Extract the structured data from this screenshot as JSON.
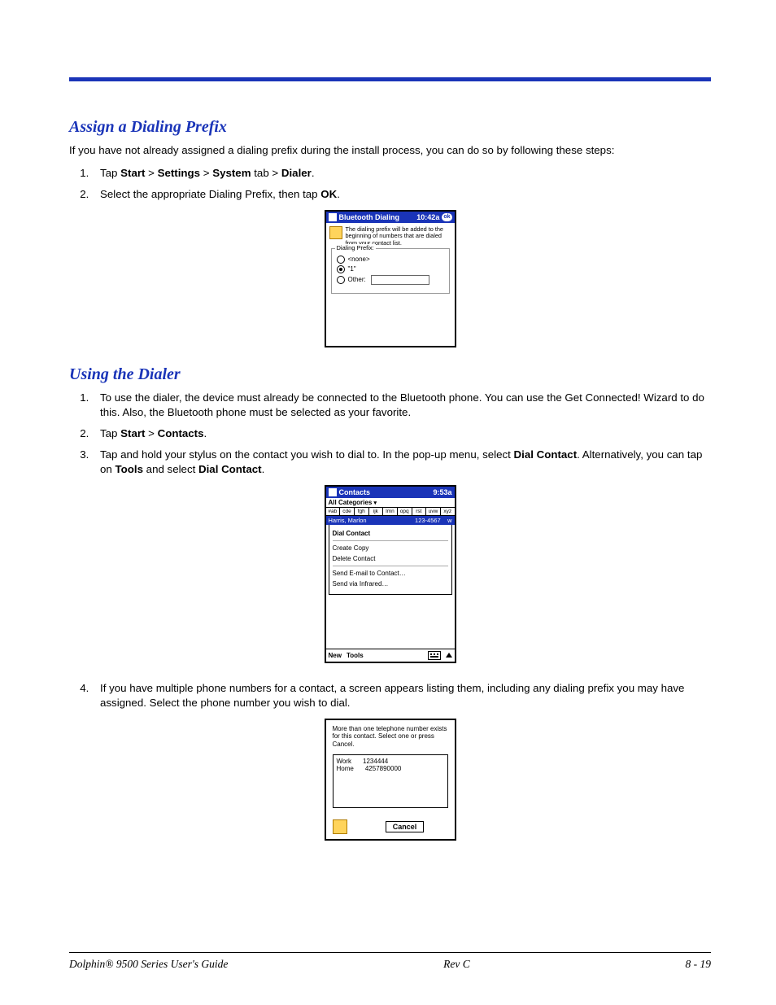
{
  "section1": {
    "heading": "Assign a Dialing Prefix",
    "intro": "If you have not already assigned a dialing prefix during the install process, you can do so by following these steps:",
    "steps": {
      "s1a": "Tap ",
      "s1b": "Start",
      "s1c": " > ",
      "s1d": "Settings",
      "s1e": " > ",
      "s1f": "System",
      "s1g": " tab > ",
      "s1h": "Dialer",
      "s1i": ".",
      "s2a": "Select the appropriate Dialing Prefix, then tap ",
      "s2b": "OK",
      "s2c": "."
    }
  },
  "shot1": {
    "title": "Bluetooth Dialing",
    "time": "10:42a",
    "ok": "ok",
    "info": "The dialing prefix will be added to the beginning of numbers that are dialed from your contact list.",
    "legend": "Dialing Prefix:",
    "opt_none": "<none>",
    "opt_one": "\"1\"",
    "opt_other": "Other:"
  },
  "section2": {
    "heading": "Using the Dialer",
    "steps": {
      "s1": "To use the dialer, the device must already be connected to the Bluetooth phone. You can use the Get Connected! Wizard to do this. Also, the Bluetooth phone must be selected as your favorite.",
      "s2a": "Tap ",
      "s2b": "Start",
      "s2c": " > ",
      "s2d": "Contacts",
      "s2e": ".",
      "s3a": "Tap and hold your stylus on the contact you wish to dial to. In the pop-up menu, select ",
      "s3b": "Dial Contact",
      "s3c": ". Alternatively, you can tap on ",
      "s3d": "Tools",
      "s3e": " and select ",
      "s3f": "Dial Contact",
      "s3g": ".",
      "s4": "If you have multiple phone numbers for a contact, a screen appears listing them, including any dialing prefix you may have assigned. Select the phone number you wish to dial."
    }
  },
  "shot2": {
    "title": "Contacts",
    "time": "9:53a",
    "categories": "All Categories ",
    "abc": [
      "#ab",
      "cde",
      "fgh",
      "ijk",
      "lmn",
      "opq",
      "rst",
      "uvw",
      "xyz"
    ],
    "sel_left": "Harris, Marlon",
    "sel_right_num": "123-4567",
    "sel_right_w": "w",
    "menu": {
      "m1": "Dial Contact",
      "m2": "Create Copy",
      "m3": "Delete Contact",
      "m4": "Send E-mail to Contact…",
      "m5": "Send via Infrared…"
    },
    "foot_new": "New",
    "foot_tools": "Tools"
  },
  "shot3": {
    "msg": "More than one telephone number exists for this contact.  Select one or press Cancel.",
    "rows": [
      {
        "type": "Work",
        "num": "1234444"
      },
      {
        "type": "Home",
        "num": "4257890000"
      }
    ],
    "cancel": "Cancel"
  },
  "footer": {
    "left": "Dolphin® 9500 Series User's Guide",
    "center": "Rev C",
    "right": "8 - 19"
  }
}
